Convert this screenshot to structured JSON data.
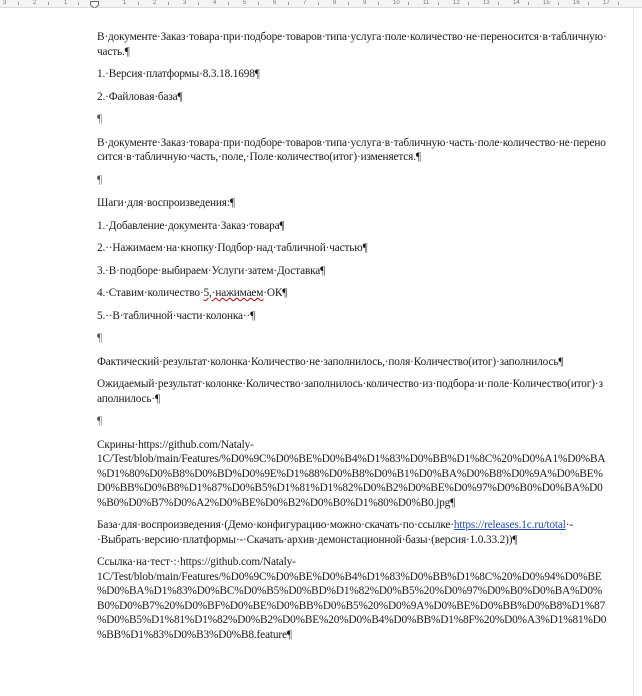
{
  "ruler": {
    "labels": [
      "3",
      "2",
      "1",
      "",
      "1",
      "2",
      "3",
      "4",
      "5",
      "6",
      "7",
      "8",
      "9",
      "10",
      "11",
      "12",
      "13",
      "14",
      "15",
      "16",
      "17"
    ]
  },
  "document": {
    "paragraphs": [
      {
        "text": "В·документе·Заказ·товара·при·подборе·товаров·типа·услуга·поле·количество·не·переносится·в·табличную·часть.¶"
      },
      {
        "text": "1.·Версия·платформы·8.3.18.1698¶"
      },
      {
        "text": "2.·Файловая·база¶"
      },
      {
        "text": "¶"
      },
      {
        "text": "В·документе·Заказ·товара·при·подборе·товаров·типа·услуга·в·табличную·часть·поле·количество·не·переносится·в·табличную·часть,·поле,·Поле·количество(итог)·изменяется.¶"
      },
      {
        "text": "¶"
      },
      {
        "text": "Шаги·для·воспроизведения:¶"
      },
      {
        "text": "1.·Добавление·документа·Заказ·товара¶"
      },
      {
        "text": "2.··Нажимаем·на·кнопку·Подбор·над·табличной·частью¶"
      },
      {
        "text": "3.·В·подборе·выбираем·Услуги·затем·Доставка¶"
      },
      {
        "text_before": "4.·Ставим·количество·",
        "squiggle": "5,·нажимаем",
        "text_after": "·ОК¶"
      },
      {
        "text": "5.··В·табличной·части·колонка··¶"
      },
      {
        "text": "¶"
      },
      {
        "text": "Фактический·результат·колонка·Количество·не·заполнилось,·поля·Количество(итог)·заполнилось¶"
      },
      {
        "text": "Ожидаемый·результат·колонке·Количество·заполнилось·количество·из·подбора·и·поле·Количество(итог)·заполнилось·¶"
      },
      {
        "text": "¶"
      },
      {
        "text": "Скрины·https://github.com/Nataly-1C/Test/blob/main/Features/%D0%9C%D0%BE%D0%B4%D1%83%D0%BB%D1%8C%20%D0%A1%D0%BA%D1%80%D0%B8%D0%BD%D0%9E%D1%88%D0%B8%D0%B1%D0%BA%D0%B8%D0%9A%D0%BE%D0%BB%D0%B8%D1%87%D0%B5%D1%81%D1%82%D0%B2%D0%BE%D0%97%D0%B0%D0%BA%D0%B0%D0%B7%D0%A2%D0%BE%D0%B2%D0%B0%D1%80%D0%B0.jpg¶"
      },
      {
        "text_before": "База·для·воспроизведения·(Демо·конфигурацию·можно·скачать·по·ссылке·",
        "link": "https://releases.1c.ru/total",
        "text_after": "·-·Выбрать·версию·платформы·-·Скачать·архив·демонстационной·базы·(версия·1.0.33.2))¶"
      },
      {
        "text": "Ссылка·на·тест·:·https://github.com/Nataly-1C/Test/blob/main/Features/%D0%9C%D0%BE%D0%B4%D1%83%D0%BB%D1%8C%20%D0%94%D0%BE%D0%BA%D1%83%D0%BC%D0%B5%D0%BD%D1%82%D0%B5%20%D0%97%D0%B0%D0%BA%D0%B0%D0%B7%20%D0%BF%D0%BE%D0%BB%D0%B5%20%D0%9A%D0%BE%D0%BB%D0%B8%D1%87%D0%B5%D1%81%D1%82%D0%B2%D0%BE%20%D0%B4%D0%BB%D1%8F%20%D0%A3%D1%81%D0%BB%D1%83%D0%B3%D0%B8.feature¶"
      }
    ]
  }
}
